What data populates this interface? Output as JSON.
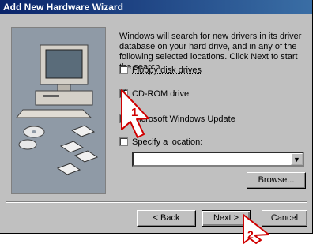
{
  "window": {
    "title": "Add New Hardware Wizard"
  },
  "description": "Windows will search for new drivers in its driver database on your hard drive, and in any of the following selected locations. Click Next to start the search.",
  "options": [
    {
      "label": "Floppy disk drives",
      "checked": false
    },
    {
      "label": "CD-ROM drive",
      "checked": true
    },
    {
      "label": "Microsoft Windows Update",
      "checked": false
    },
    {
      "label": "Specify a location:",
      "checked": false
    }
  ],
  "location": {
    "value": ""
  },
  "buttons": {
    "browse": "Browse...",
    "back": "< Back",
    "next": "Next >",
    "cancel": "Cancel"
  },
  "callouts": {
    "one": "1",
    "two": "2"
  },
  "colors": {
    "title_bar": "#0a246a",
    "face": "#c0c0c0",
    "callout_fill": "#ffffff"
  }
}
